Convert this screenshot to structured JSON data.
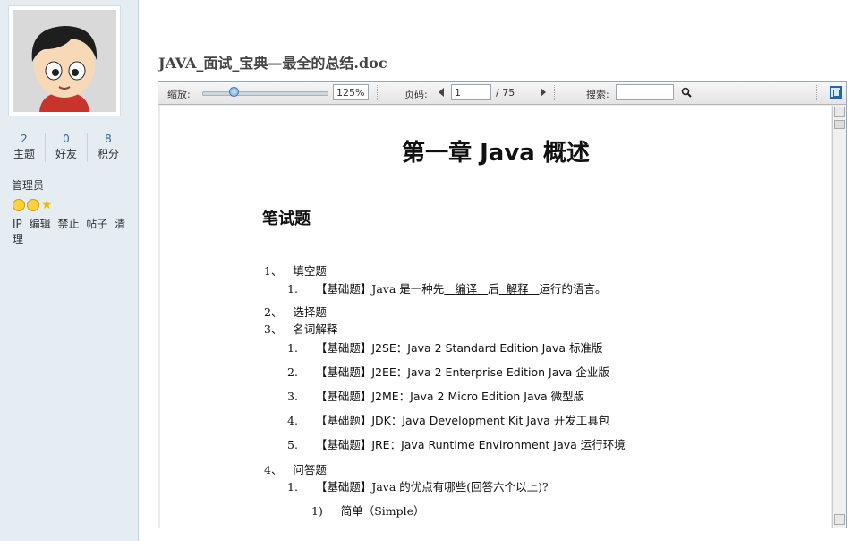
{
  "sidebar": {
    "stats": [
      {
        "num": "2",
        "label": "主题"
      },
      {
        "num": "0",
        "label": "好友"
      },
      {
        "num": "8",
        "label": "积分"
      }
    ],
    "usergroup": "管理员",
    "admin_links": [
      "IP",
      "编辑",
      "禁止",
      "帖子",
      "清理"
    ]
  },
  "doc_title": "JAVA_面试_宝典—最全的总结.doc",
  "toolbar": {
    "zoom_label": "缩放:",
    "zoom_value": "125%",
    "page_label": "页码:",
    "page_value": "1",
    "page_total": "/ 75",
    "search_label": "搜索:",
    "search_placeholder": "",
    "zoom_level": 0.25
  },
  "document": {
    "chapter_title": "第一章  Java 概述",
    "section_title": "笔试题",
    "lines": [
      {
        "num": "1、",
        "text": "填空题"
      },
      {
        "num": "1.",
        "pre": "【基础题】Java 是一种先",
        "b1": "编译",
        "mid": "后",
        "b2": "解释",
        "post": "运行的语言。"
      },
      {
        "num": "2、",
        "text": "选择题"
      },
      {
        "num": "3、",
        "text": "名词解释"
      },
      {
        "num": "1.",
        "text": "【基础题】J2SE：Java 2 Standard Edition    Java 标准版"
      },
      {
        "num": "2.",
        "text": "【基础题】J2EE：Java 2 Enterprise Edition   Java 企业版"
      },
      {
        "num": "3.",
        "text": "【基础题】J2ME：Java 2 Micro Edition       Java 微型版"
      },
      {
        "num": "4.",
        "text": "【基础题】JDK：Java Development Kit       Java 开发工具包"
      },
      {
        "num": "5.",
        "text": "【基础题】JRE：Java Runtime Environment   Java 运行环境"
      },
      {
        "num": "4、",
        "text": "问答题"
      },
      {
        "num": "1.",
        "text": "【基础题】Java 的优点有哪些(回答六个以上)?"
      },
      {
        "num": "1)",
        "text": "简单（Simple）"
      }
    ]
  }
}
